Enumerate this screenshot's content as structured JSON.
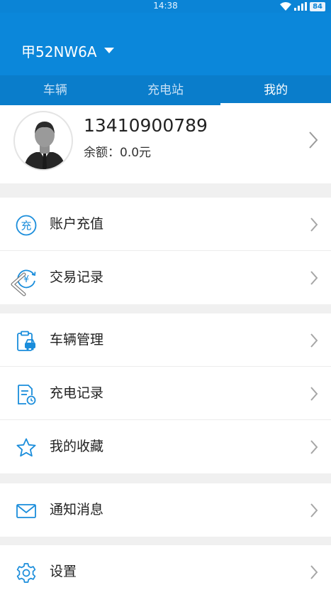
{
  "status_bar": {
    "time": "14:38",
    "battery": "84"
  },
  "header": {
    "plate": "甲52NW6A"
  },
  "tabs": [
    {
      "label": "车辆",
      "active": false
    },
    {
      "label": "充电站",
      "active": false
    },
    {
      "label": "我的",
      "active": true
    }
  ],
  "profile": {
    "phone": "13410900789",
    "balance": "余额：0.0元"
  },
  "menu": {
    "account_recharge": "账户充值",
    "transactions": "交易记录",
    "vehicle_management": "车辆管理",
    "charging_records": "充电记录",
    "favorites": "我的收藏",
    "notifications": "通知消息",
    "settings": "设置"
  },
  "icons": {
    "recharge_glyph": "充",
    "yen_glyph": "¥"
  },
  "colors": {
    "primary": "#0b87da",
    "tab_bar": "#0a7dcb",
    "icon_blue": "#1a8ddb"
  }
}
